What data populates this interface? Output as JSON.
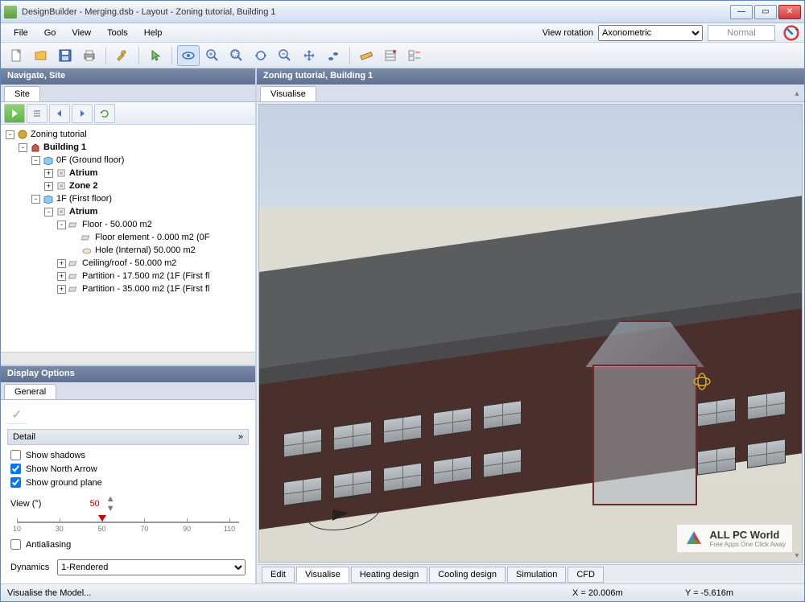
{
  "window": {
    "title": "DesignBuilder - Merging.dsb - Layout - Zoning tutorial, Building 1"
  },
  "menu": {
    "items": [
      "File",
      "Go",
      "View",
      "Tools",
      "Help"
    ],
    "view_rotation_label": "View rotation",
    "view_rotation_value": "Axonometric",
    "normal_label": "Normal"
  },
  "navigate": {
    "header": "Navigate, Site",
    "tab": "Site",
    "tree": [
      {
        "indent": 0,
        "exp": "-",
        "icon": "globe",
        "label": "Zoning tutorial",
        "bold": false
      },
      {
        "indent": 1,
        "exp": "-",
        "icon": "building",
        "label": "Building 1",
        "bold": true
      },
      {
        "indent": 2,
        "exp": "-",
        "icon": "block",
        "label": "0F (Ground floor)",
        "bold": false
      },
      {
        "indent": 3,
        "exp": "+",
        "icon": "zone",
        "label": "Atrium",
        "bold": true
      },
      {
        "indent": 3,
        "exp": "+",
        "icon": "zone",
        "label": "Zone 2",
        "bold": true
      },
      {
        "indent": 2,
        "exp": "-",
        "icon": "block",
        "label": "1F (First floor)",
        "bold": false
      },
      {
        "indent": 3,
        "exp": "-",
        "icon": "zone",
        "label": "Atrium",
        "bold": true
      },
      {
        "indent": 4,
        "exp": "-",
        "icon": "surf",
        "label": "Floor - 50.000 m2",
        "bold": false
      },
      {
        "indent": 5,
        "exp": "",
        "icon": "surf",
        "label": "Floor element - 0.000 m2 (0F",
        "bold": false
      },
      {
        "indent": 5,
        "exp": "",
        "icon": "hole",
        "label": "Hole (Internal) 50.000 m2",
        "bold": false
      },
      {
        "indent": 4,
        "exp": "+",
        "icon": "surf",
        "label": "Ceiling/roof - 50.000 m2",
        "bold": false
      },
      {
        "indent": 4,
        "exp": "+",
        "icon": "surf",
        "label": "Partition - 17.500 m2 (1F (First fl",
        "bold": false
      },
      {
        "indent": 4,
        "exp": "+",
        "icon": "surf",
        "label": "Partition - 35.000 m2 (1F (First fl",
        "bold": false
      }
    ]
  },
  "display": {
    "header": "Display Options",
    "tab": "General",
    "detail_label": "Detail",
    "show_shadows": {
      "label": "Show shadows",
      "checked": false
    },
    "show_north": {
      "label": "Show North Arrow",
      "checked": true
    },
    "show_ground": {
      "label": "Show ground plane",
      "checked": true
    },
    "view_label": "View (°)",
    "view_value": "50",
    "ticks": [
      "10",
      "30",
      "50",
      "70",
      "90",
      "110"
    ],
    "antialiasing": {
      "label": "Antialiasing",
      "checked": false
    },
    "dynamics_label": "Dynamics",
    "dynamics_value": "1-Rendered"
  },
  "viewport": {
    "header": "Zoning tutorial, Building 1",
    "tab": "Visualise",
    "watermark_l1": "ALL PC World",
    "watermark_l2": "Free Apps One Click Away"
  },
  "bottom_tabs": [
    "Edit",
    "Visualise",
    "Heating design",
    "Cooling design",
    "Simulation",
    "CFD"
  ],
  "bottom_active": 1,
  "status": {
    "message": "Visualise the Model...",
    "x": "X = 20.006m",
    "y": "Y = -5.616m"
  }
}
